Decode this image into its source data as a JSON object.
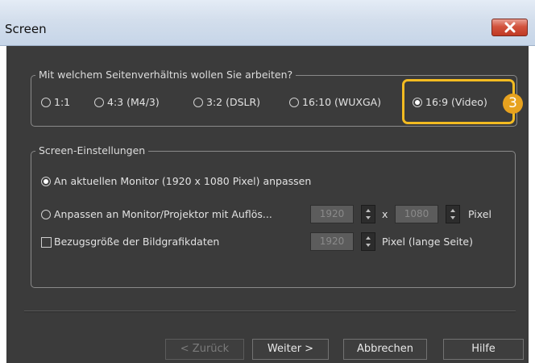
{
  "window": {
    "title": "Screen"
  },
  "ratio_group": {
    "title": "Mit welchem Seitenverhältnis wollen Sie arbeiten?",
    "options": [
      {
        "label": "1:1",
        "selected": false
      },
      {
        "label": "4:3 (M4/3)",
        "selected": false
      },
      {
        "label": "3:2 (DSLR)",
        "selected": false
      },
      {
        "label": "16:10 (WUXGA)",
        "selected": false
      },
      {
        "label": "16:9 (Video)",
        "selected": true
      }
    ],
    "step_badge": "3"
  },
  "screen_group": {
    "title": "Screen-Einstellungen",
    "option_current_monitor": {
      "label": "An aktuellen Monitor (1920 x 1080 Pixel) anpassen",
      "selected": true
    },
    "option_custom": {
      "label": "Anpassen an Monitor/Projektor mit Auflös...",
      "selected": false,
      "width_value": "1920",
      "times": "x",
      "height_value": "1080",
      "unit": "Pixel"
    },
    "reference_size": {
      "label": "Bezugsgröße der Bildgrafikdaten",
      "checked": false,
      "value": "1920",
      "unit": "Pixel (lange Seite)"
    }
  },
  "buttons": {
    "back": "< Zurück",
    "next": "Weiter >",
    "cancel": "Abbrechen",
    "help": "Hilfe"
  },
  "colors": {
    "highlight": "#f3bb21",
    "badge": "#e7a21f",
    "close": "#c03a24"
  }
}
